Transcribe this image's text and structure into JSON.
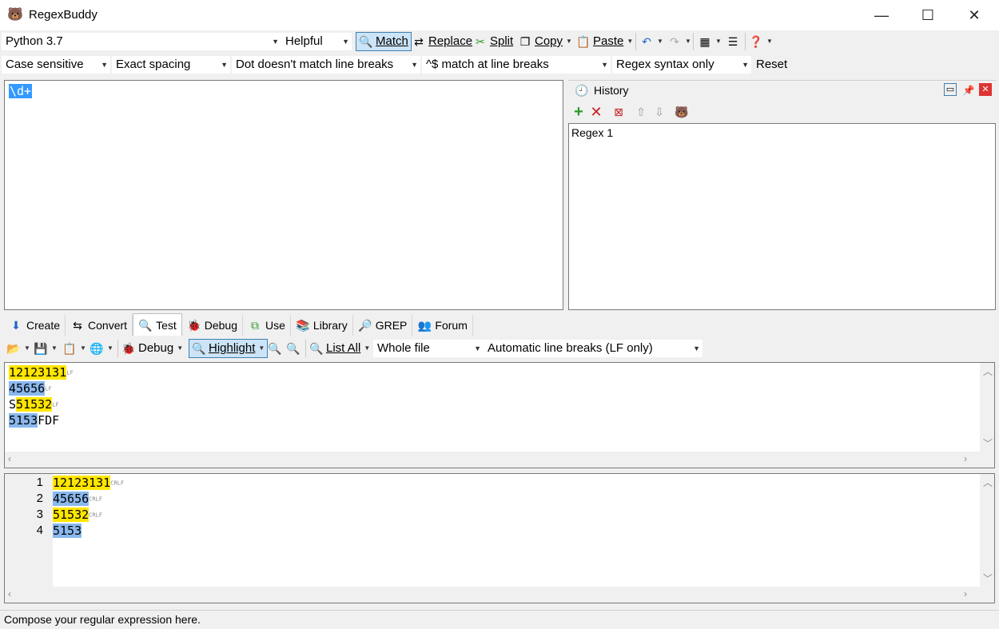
{
  "window": {
    "title": "RegexBuddy",
    "minimize": "—",
    "maximize": "☐",
    "close": "✕"
  },
  "toolbar1": {
    "flavor": "Python 3.7",
    "help_mode": "Helpful",
    "match": "Match",
    "replace": "Replace",
    "split": "Split",
    "copy": "Copy",
    "paste": "Paste"
  },
  "toolbar2": {
    "case": "Case sensitive",
    "spacing": "Exact spacing",
    "dot": "Dot doesn't match line breaks",
    "anchors": "^$ match at line breaks",
    "syntax": "Regex syntax only",
    "reset": "Reset"
  },
  "regex": {
    "text": "\\d+"
  },
  "history": {
    "title": "History",
    "items": [
      "Regex 1"
    ]
  },
  "tabs": [
    "Create",
    "Convert",
    "Test",
    "Debug",
    "Use",
    "Library",
    "GREP",
    "Forum"
  ],
  "test_toolbar": {
    "debug": "Debug",
    "highlight": "Highlight",
    "list_all": "List All",
    "scope": "Whole file",
    "line_breaks": "Automatic line breaks (LF only)"
  },
  "test_lines": [
    {
      "pre": "",
      "match": "12123131",
      "post": "",
      "cls": "hy",
      "lb": "LF"
    },
    {
      "pre": "",
      "match": "45656",
      "post": "",
      "cls": "hb",
      "lb": "LF"
    },
    {
      "pre": "S",
      "match": "51532",
      "post": "",
      "cls": "hy",
      "lb": "LF"
    },
    {
      "pre": "",
      "match": "5153",
      "post": "FDF",
      "cls": "hb",
      "lb": ""
    }
  ],
  "results": [
    {
      "num": "1",
      "text": "12123131",
      "cls": "hy",
      "lb": "CRLF"
    },
    {
      "num": "2",
      "text": "45656",
      "cls": "hb",
      "lb": "CRLF"
    },
    {
      "num": "3",
      "text": "51532",
      "cls": "hy",
      "lb": "CRLF"
    },
    {
      "num": "4",
      "text": "5153",
      "cls": "hb",
      "lb": ""
    }
  ],
  "status": "Compose your regular expression here.",
  "colors": {
    "match_yellow": "#ffe600",
    "match_blue": "#8ab8ee",
    "selection": "#3399ff"
  }
}
